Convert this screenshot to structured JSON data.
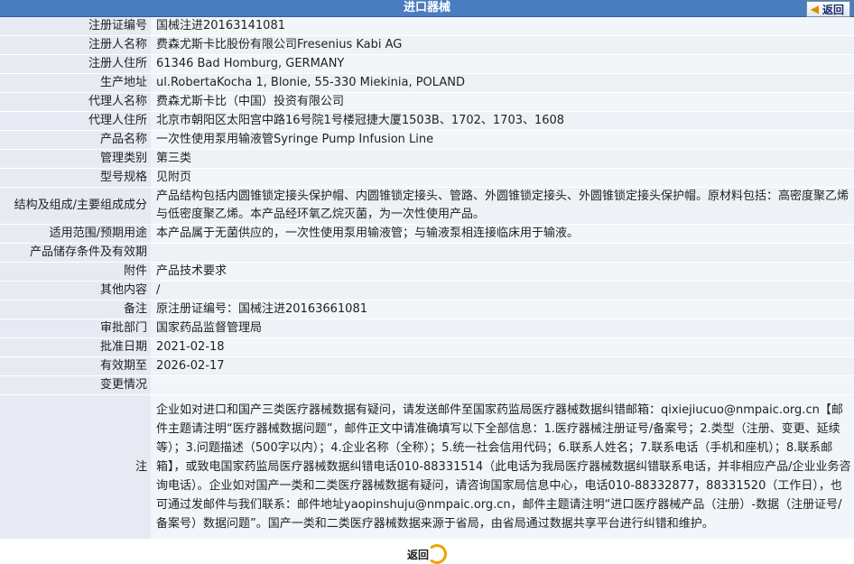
{
  "header": {
    "title": "进口器械",
    "back_label": "返回"
  },
  "rows": [
    {
      "label": "注册证编号",
      "value": "国械注进20163141081"
    },
    {
      "label": "注册人名称",
      "value": "费森尤斯卡比股份有限公司Fresenius Kabi AG"
    },
    {
      "label": "注册人住所",
      "value": "61346 Bad Homburg, GERMANY"
    },
    {
      "label": "生产地址",
      "value": "ul.RobertaKocha 1, Blonie, 55-330 Miekinia, POLAND"
    },
    {
      "label": "代理人名称",
      "value": "费森尤斯卡比（中国）投资有限公司"
    },
    {
      "label": "代理人住所",
      "value": "北京市朝阳区太阳宫中路16号院1号楼冠捷大厦1503B、1702、1703、1608"
    },
    {
      "label": "产品名称",
      "value": "一次性使用泵用输液管Syringe Pump Infusion Line"
    },
    {
      "label": "管理类别",
      "value": "第三类"
    },
    {
      "label": "型号规格",
      "value": "见附页"
    },
    {
      "label": "结构及组成/主要组成成分",
      "value": "产品结构包括内圆锥锁定接头保护帽、内圆锥锁定接头、管路、外圆锥锁定接头、外圆锥锁定接头保护帽。原材料包括：高密度聚乙烯与低密度聚乙烯。本产品经环氧乙烷灭菌，为一次性使用产品。"
    },
    {
      "label": "适用范围/预期用途",
      "value": "本产品属于无菌供应的，一次性使用泵用输液管；与输液泵相连接临床用于输液。"
    },
    {
      "label": "产品储存条件及有效期",
      "value": ""
    },
    {
      "label": "附件",
      "value": "产品技术要求"
    },
    {
      "label": "其他内容",
      "value": "/"
    },
    {
      "label": "备注",
      "value": "原注册证编号：国械注进20163661081"
    },
    {
      "label": "审批部门",
      "value": "国家药品监督管理局"
    },
    {
      "label": "批准日期",
      "value": "2021-02-18"
    },
    {
      "label": "有效期至",
      "value": "2026-02-17"
    },
    {
      "label": "变更情况",
      "value": ""
    }
  ],
  "note": {
    "label": "注",
    "text": "企业如对进口和国产三类医疗器械数据有疑问，请发送邮件至国家药监局医疗器械数据纠错邮箱：qixiejiucuo@nmpaic.org.cn【邮件主题请注明“医疗器械数据问题”，邮件正文中请准确填写以下全部信息：1.医疗器械注册证号/备案号；2.类型（注册、变更、延续等）；3.问题描述（500字以内）；4.企业名称（全称）；5.统一社会信用代码；6.联系人姓名；7.联系电话（手机和座机）；8.联系邮箱】，或致电国家药监局医疗器械数据纠错电话010-88331514（此电话为我局医疗器械数据纠错联系电话，并非相应产品/企业业务咨询电话）。企业如对国产一类和二类医疗器械数据有疑问，请咨询国家局信息中心，电话010-88332877，88331520（工作日），也可通过发邮件与我们联系：邮件地址yaopinshuju@nmpaic.org.cn，邮件主题请注明“进口医疗器械产品（注册）-数据（注册证号/备案号）数据问题”。国产一类和二类医疗器械数据来源于省局，由省局通过数据共享平台进行纠错和维护。"
  },
  "footer": {
    "back_label": "返回"
  }
}
